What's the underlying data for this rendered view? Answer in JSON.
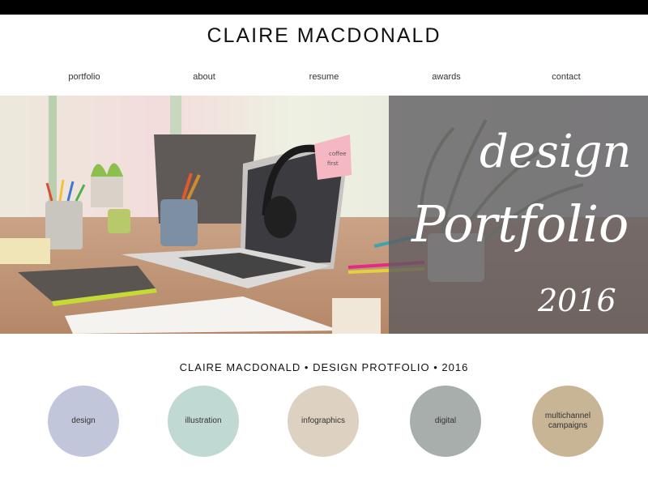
{
  "site": {
    "title": "CLAIRE MACDONALD"
  },
  "nav": [
    {
      "label": "portfolio"
    },
    {
      "label": "about"
    },
    {
      "label": "resume"
    },
    {
      "label": "awards"
    },
    {
      "label": "contact"
    }
  ],
  "hero": {
    "script_line1": "design",
    "script_line2": "Portfolio",
    "script_year": "2016",
    "sticky_note_line1": "coffee",
    "sticky_note_line2": "first"
  },
  "tagline": "CLAIRE MACDONALD • DESIGN PROTFOLIO • 2016",
  "categories": [
    {
      "label": "design",
      "color": "#c2c6da"
    },
    {
      "label": "illustration",
      "color": "#c0dad3"
    },
    {
      "label": "infographics",
      "color": "#ddd2c1"
    },
    {
      "label": "digital",
      "color": "#a8aeab"
    },
    {
      "label_line1": "multichannel",
      "label_line2": "campaigns",
      "color": "#c8b596"
    }
  ]
}
